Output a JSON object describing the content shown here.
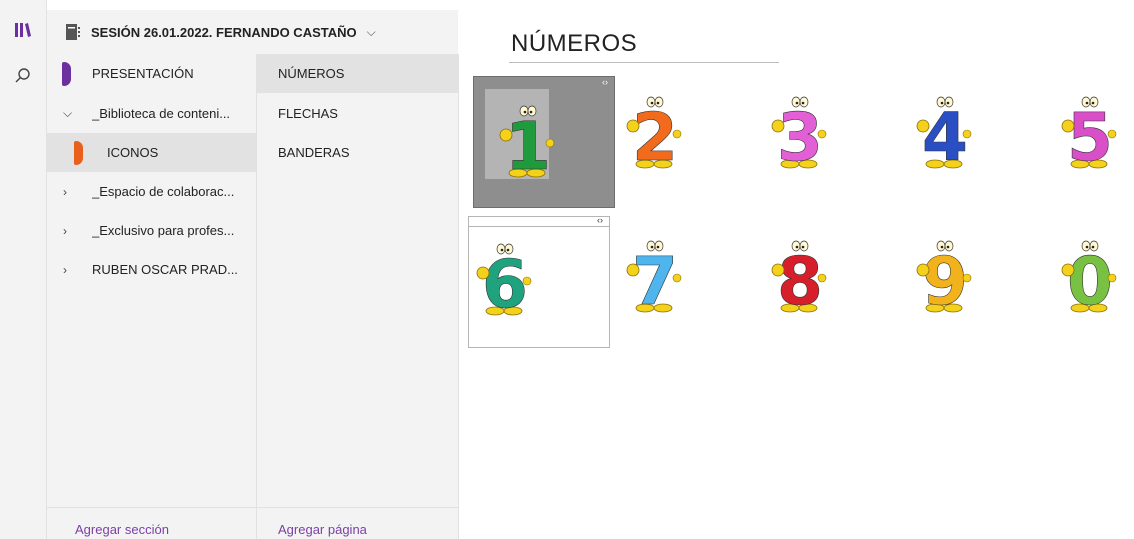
{
  "rail": {
    "library_icon": "library-icon",
    "search_icon": "search-icon"
  },
  "notebook": {
    "title": "SESIÓN 26.01.2022. FERNANDO CASTAÑO",
    "chevron": "⌵"
  },
  "sections": [
    {
      "label": "PRESENTACIÓN",
      "color": "#6b2fa0",
      "expander": "",
      "selected": false
    },
    {
      "label": "_Biblioteca de conteni...",
      "color": "",
      "expander": "⌵",
      "selected": false
    },
    {
      "label": "ICONOS",
      "color": "#e8601c",
      "expander": "",
      "selected": true
    },
    {
      "label": "_Espacio de colaborac...",
      "color": "",
      "expander": "›",
      "selected": false
    },
    {
      "label": "_Exclusivo para profes...",
      "color": "",
      "expander": "›",
      "selected": false
    },
    {
      "label": "RUBEN OSCAR PRAD...",
      "color": "",
      "expander": "›",
      "selected": false
    }
  ],
  "pages": [
    {
      "label": "NÚMEROS",
      "selected": true
    },
    {
      "label": "FLECHAS",
      "selected": false
    },
    {
      "label": "BANDERAS",
      "selected": false
    }
  ],
  "footer": {
    "add_section": "Agregar sección",
    "add_page": "Agregar página"
  },
  "canvas": {
    "title": "NÚMEROS",
    "handle_glyph": "‹›",
    "digits": [
      {
        "digit": "1",
        "color": "#1f9a3c"
      },
      {
        "digit": "2",
        "color": "#f26a1b"
      },
      {
        "digit": "3",
        "color": "#e35fd6"
      },
      {
        "digit": "4",
        "color": "#2a4fc4"
      },
      {
        "digit": "5",
        "color": "#d94fc8"
      },
      {
        "digit": "6",
        "color": "#1fa37f"
      },
      {
        "digit": "7",
        "color": "#4fb5ee"
      },
      {
        "digit": "8",
        "color": "#d61f2a"
      },
      {
        "digit": "9",
        "color": "#f2b21c"
      },
      {
        "digit": "0",
        "color": "#78c142"
      }
    ]
  }
}
